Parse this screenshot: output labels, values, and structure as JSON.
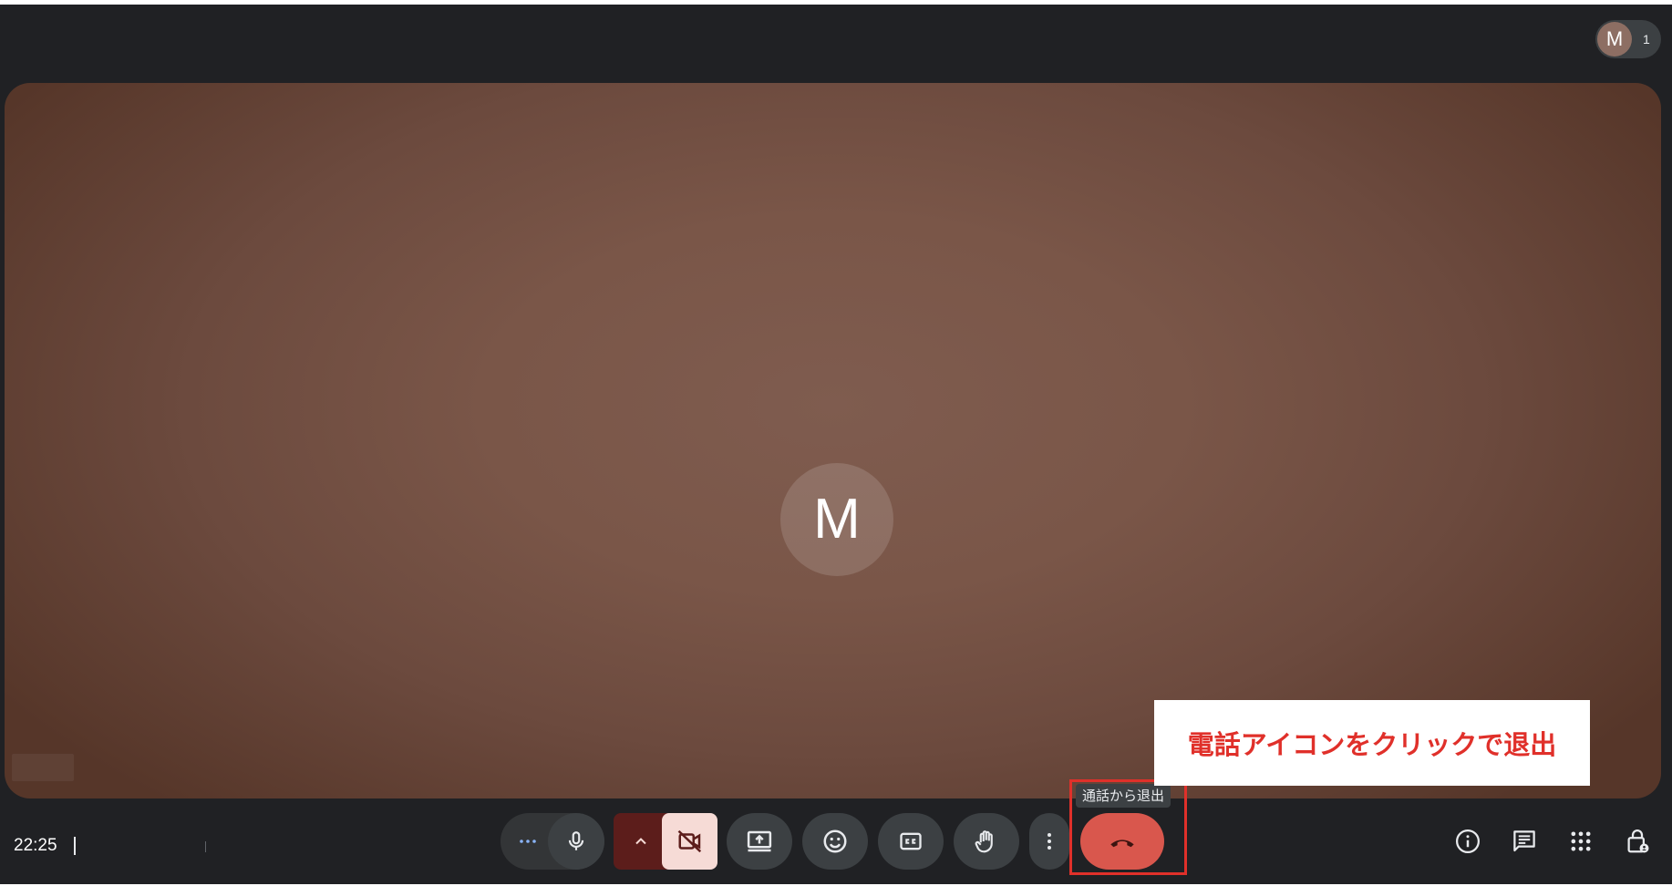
{
  "participants": {
    "avatar_initial": "M",
    "count": "1"
  },
  "stage": {
    "avatar_initial": "M"
  },
  "footer": {
    "time": "22:25"
  },
  "controls": {
    "more_dots_icon": "more-horiz-icon",
    "mic_icon": "mic-icon",
    "camera_options_icon": "chevron-up-icon",
    "camera_icon": "videocam-off-icon",
    "present_icon": "present-to-all-icon",
    "reactions_icon": "emoji-icon",
    "captions_icon": "closed-caption-icon",
    "raise_hand_icon": "hand-icon",
    "more_options_icon": "more-vert-icon",
    "leave_call_icon": "call-end-icon"
  },
  "tooltip": {
    "leave_call": "通話から退出"
  },
  "annotation": {
    "text": "電話アイコンをクリックで退出"
  },
  "right_panel": [
    "info-icon",
    "chat-icon",
    "apps-icon",
    "host-controls-icon"
  ],
  "colors": {
    "background": "#202124",
    "button": "#3c4043",
    "leave_call": "#d9574d",
    "camera_off_bg": "#f6dbd6",
    "camera_group": "#5c1d1b",
    "annotation_red": "#e0302a"
  }
}
